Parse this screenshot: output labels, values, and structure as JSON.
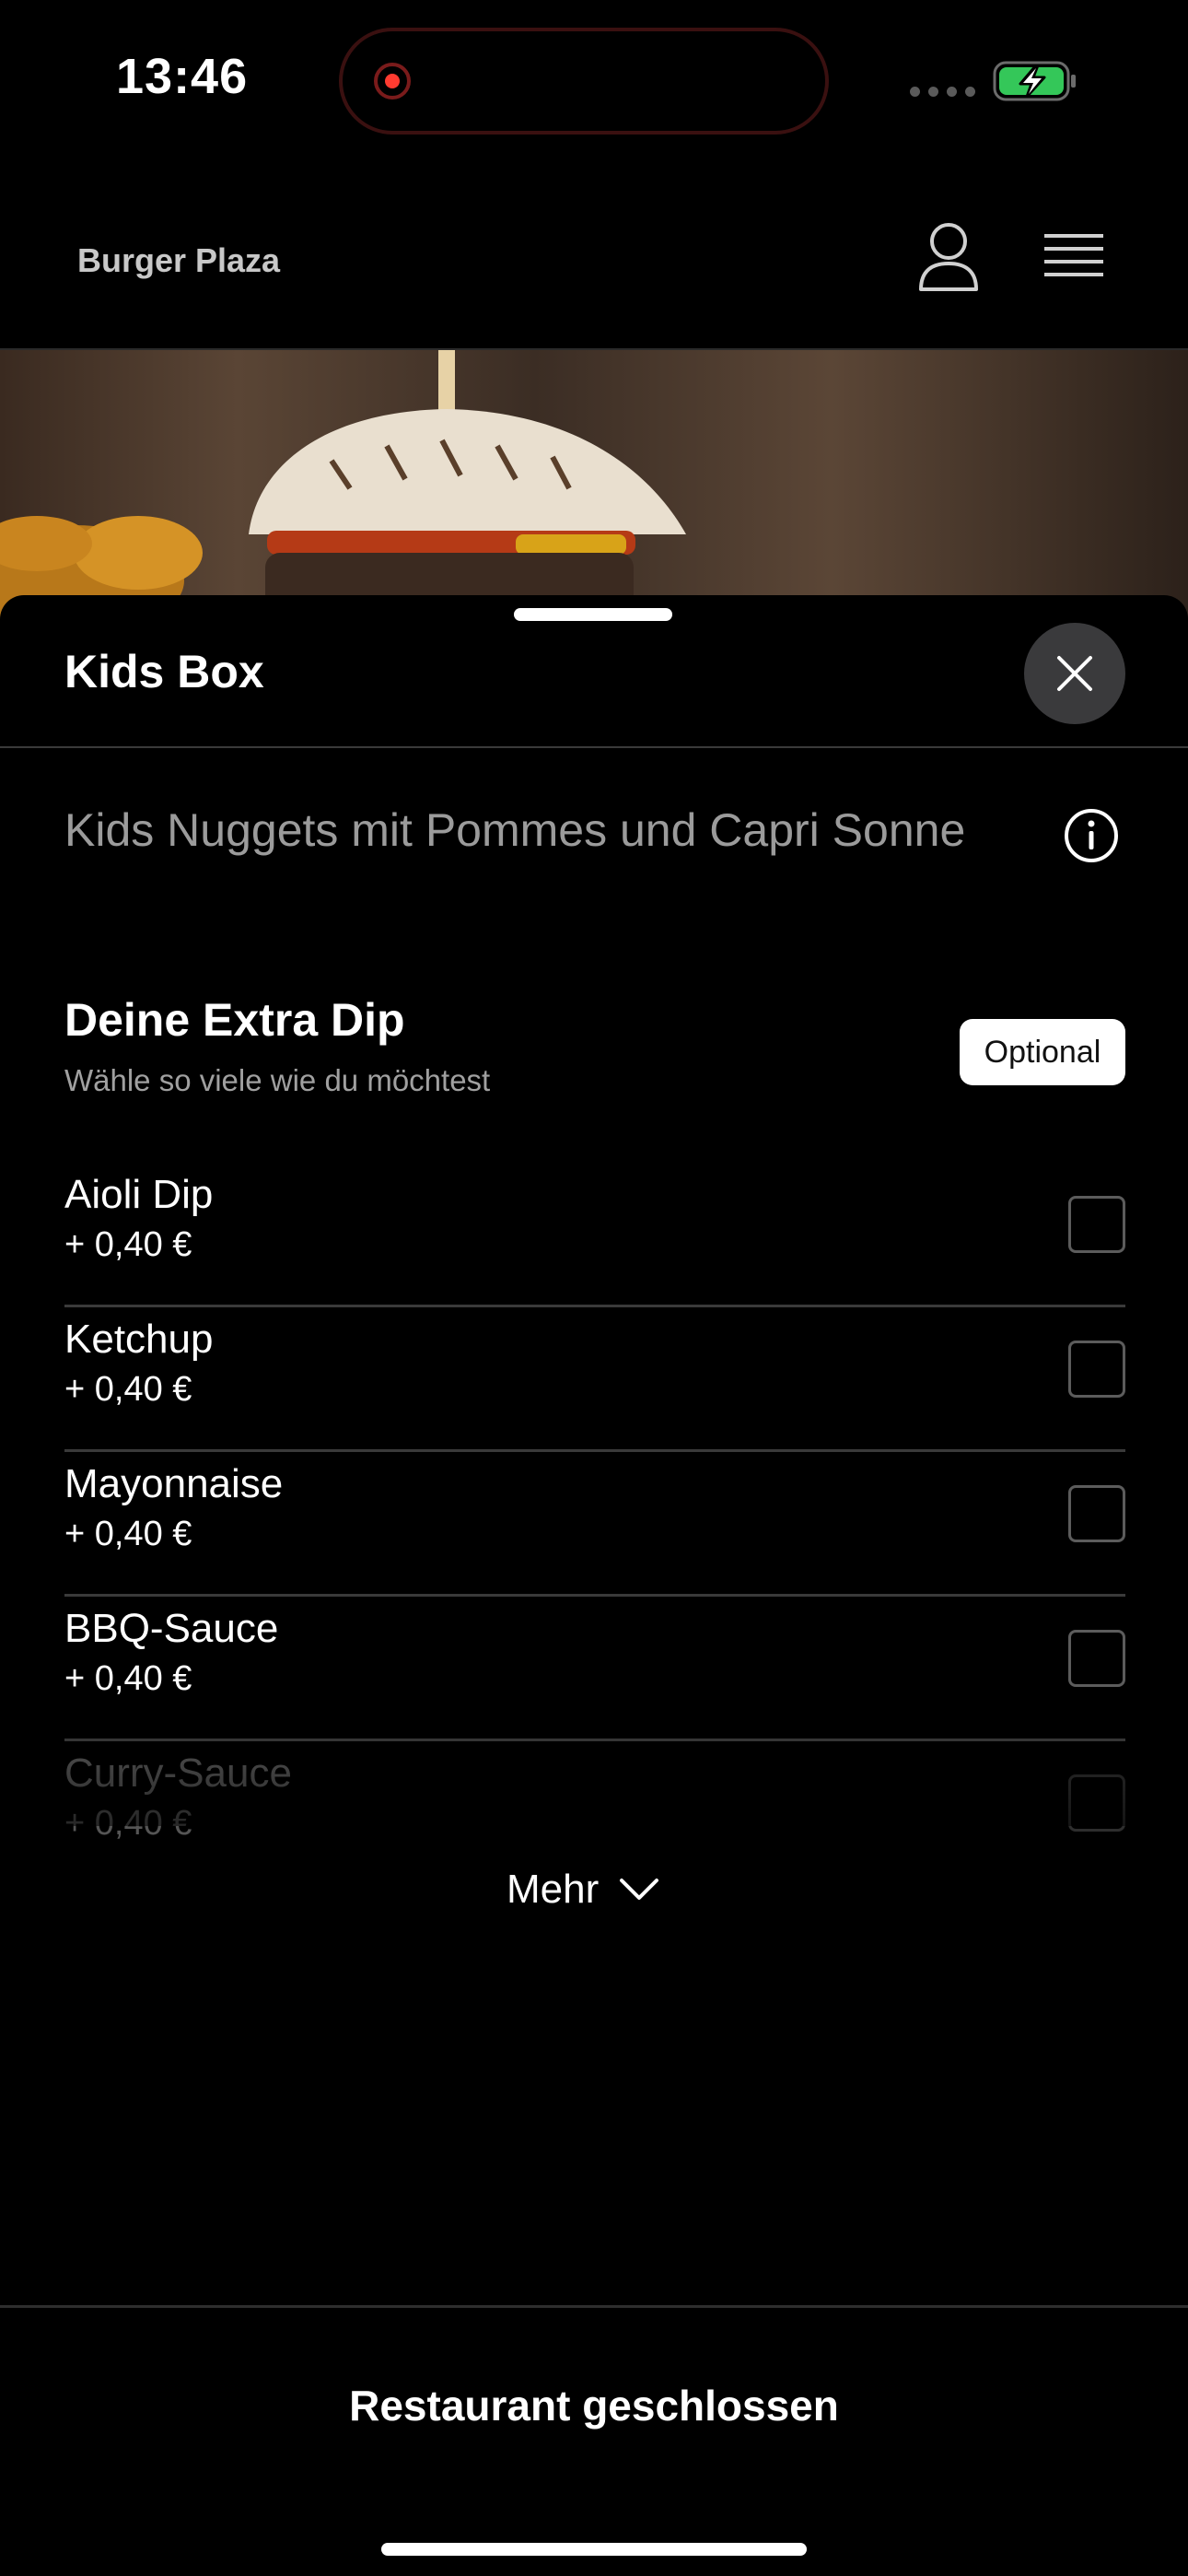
{
  "status_bar": {
    "time": "13:46"
  },
  "header": {
    "brand": "Burger Plaza",
    "icons": [
      "user-icon",
      "hamburger-menu-icon"
    ]
  },
  "sheet": {
    "title": "Kids Box",
    "description": "Kids Nuggets mit Pommes und Capri Sonne",
    "close_icon": "close-icon",
    "info_icon": "info-icon"
  },
  "group": {
    "title": "Deine Extra Dip",
    "subtitle": "Wähle so viele wie du möchtest",
    "badge": "Optional",
    "options": [
      {
        "name": "Aioli Dip",
        "price": "+ 0,40 €",
        "checked": false
      },
      {
        "name": "Ketchup",
        "price": "+ 0,40 €",
        "checked": false
      },
      {
        "name": "Mayonnaise",
        "price": "+ 0,40 €",
        "checked": false
      },
      {
        "name": "BBQ-Sauce",
        "price": "+ 0,40 €",
        "checked": false
      },
      {
        "name": "Curry-Sauce",
        "price": "+ 0,40 €",
        "checked": false
      }
    ],
    "more_label": "Mehr"
  },
  "footer": {
    "status": "Restaurant geschlossen"
  },
  "colors": {
    "background": "#000000",
    "recording_red": "#ff3b30",
    "battery_green": "#34c759",
    "close_button": "#3a3a3c"
  }
}
